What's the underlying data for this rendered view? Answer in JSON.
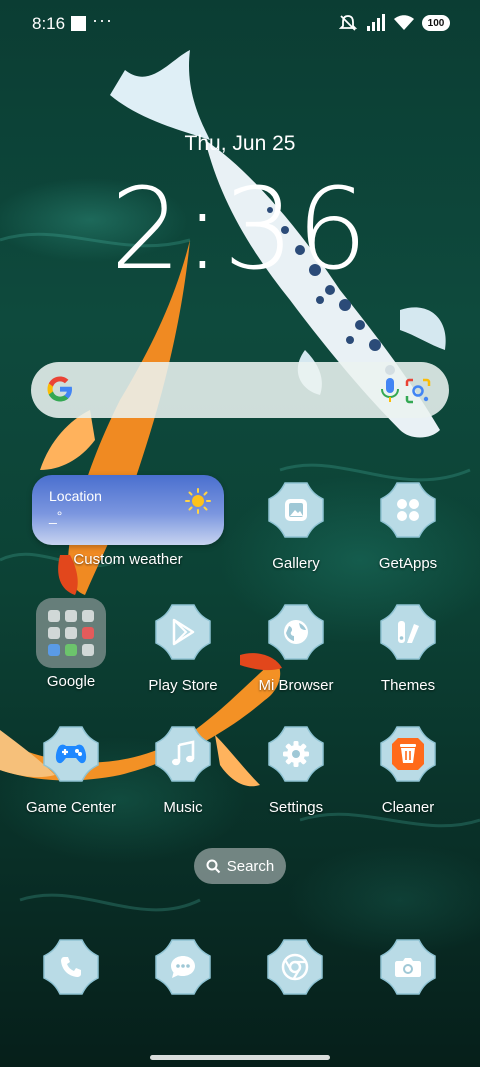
{
  "status_bar": {
    "time": "8:16",
    "dots": "···",
    "battery": "100",
    "icons": [
      "notification-square-icon",
      "bell-muted-icon",
      "signal-icon",
      "wifi-icon",
      "battery-icon"
    ]
  },
  "clock": {
    "date": "Thu, Jun 25",
    "time": "2:36"
  },
  "google_search": {
    "icons": [
      "google-g-icon",
      "mic-icon",
      "lens-icon"
    ]
  },
  "weather_widget": {
    "location": "Location",
    "temperature": "_°",
    "label": "Custom weather",
    "icon": "sun-icon"
  },
  "apps_row1": [
    {
      "label": "Gallery",
      "icon": "gallery-icon"
    },
    {
      "label": "GetApps",
      "icon": "getapps-icon"
    }
  ],
  "folder": {
    "label": "Google"
  },
  "apps_row2": [
    {
      "label": "Play Store",
      "icon": "play-store-icon"
    },
    {
      "label": "Mi Browser",
      "icon": "globe-icon"
    },
    {
      "label": "Themes",
      "icon": "themes-icon"
    }
  ],
  "apps_row3": [
    {
      "label": "Game Center",
      "icon": "gamepad-icon"
    },
    {
      "label": "Music",
      "icon": "music-note-icon"
    },
    {
      "label": "Settings",
      "icon": "gear-icon"
    },
    {
      "label": "Cleaner",
      "icon": "trash-icon"
    }
  ],
  "drawer_search": {
    "label": "Search",
    "icon": "search-icon"
  },
  "dock": [
    {
      "name": "phone",
      "icon": "phone-icon"
    },
    {
      "name": "messages",
      "icon": "chat-icon"
    },
    {
      "name": "chrome",
      "icon": "chrome-icon"
    },
    {
      "name": "camera",
      "icon": "camera-icon"
    }
  ],
  "colors": {
    "icon_tile": "#b9dbe6",
    "icon_tile_edge": "#8fc3d3",
    "weather_top": "#4a6fcf",
    "cleaner_accent": "#ff6a1a",
    "game_accent": "#1e88ff"
  }
}
